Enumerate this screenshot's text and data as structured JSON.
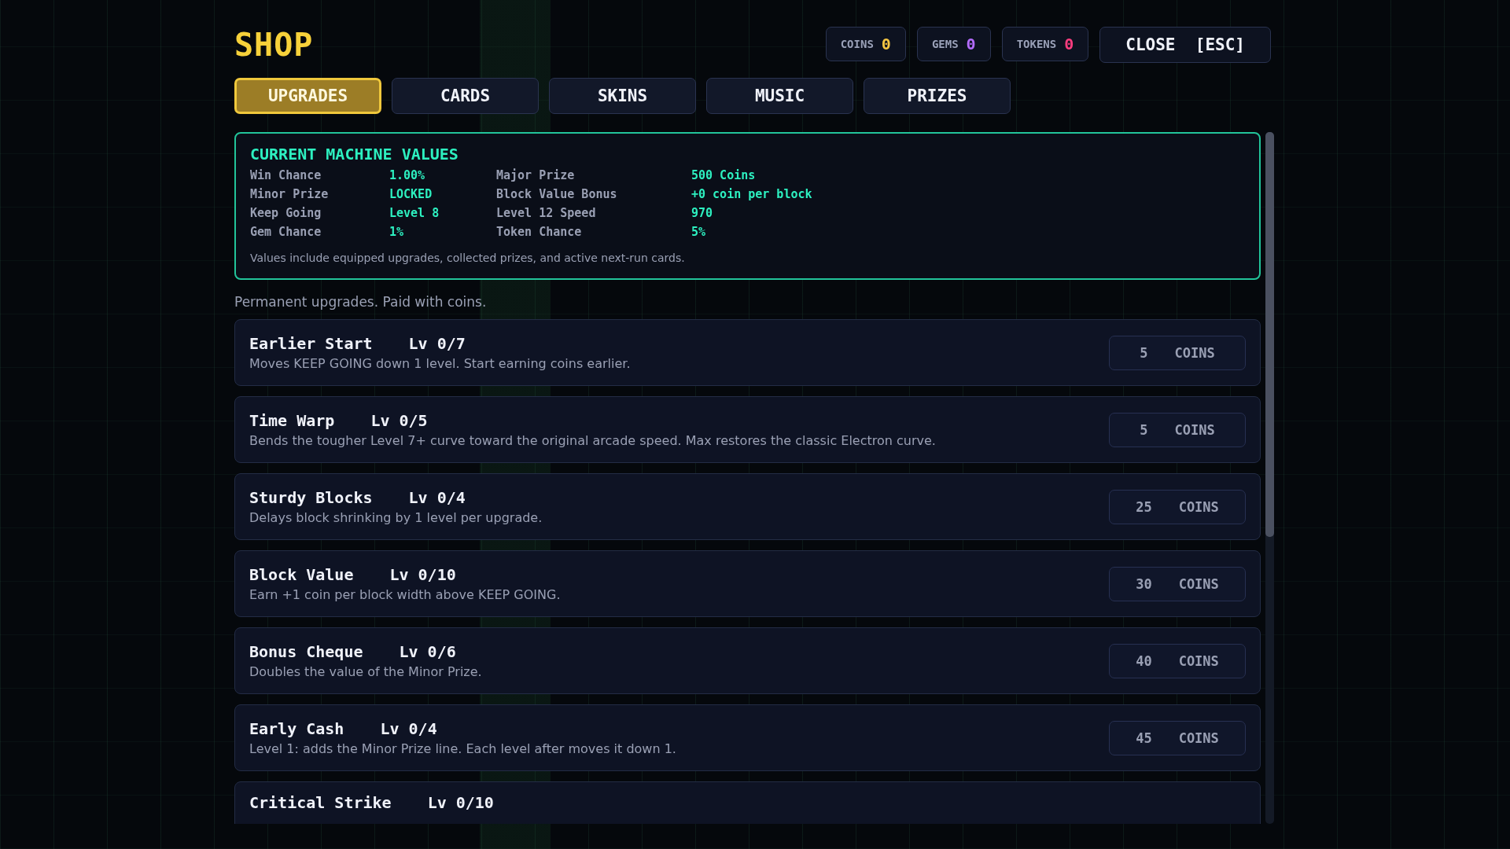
{
  "title": "SHOP",
  "currencies": [
    {
      "label": "COINS",
      "value": "0",
      "color": "#f5c542"
    },
    {
      "label": "GEMS",
      "value": "0",
      "color": "#b46cff"
    },
    {
      "label": "TOKENS",
      "value": "0",
      "color": "#ff3d7f"
    }
  ],
  "close_button": "CLOSE  [ESC]",
  "tabs": [
    {
      "label": "UPGRADES",
      "selected": true
    },
    {
      "label": "CARDS",
      "selected": false
    },
    {
      "label": "SKINS",
      "selected": false
    },
    {
      "label": "MUSIC",
      "selected": false
    },
    {
      "label": "PRIZES",
      "selected": false
    }
  ],
  "machine_values": {
    "title": "CURRENT MACHINE VALUES",
    "rows": [
      {
        "label": "Win Chance",
        "value": "1.00%",
        "label_2": "Major Prize",
        "value_2": "500 Coins"
      },
      {
        "label": "Minor Prize",
        "value": "LOCKED",
        "label_2": "Block Value Bonus",
        "value_2": "+0 coin per block"
      },
      {
        "label": "Keep Going",
        "value": "Level 8",
        "label_2": "Level 12 Speed",
        "value_2": "970"
      },
      {
        "label": "Gem Chance",
        "value": "1%",
        "label_2": "Token Chance",
        "value_2": "5%"
      }
    ],
    "note": "Values include equipped upgrades, collected prizes, and active next-run cards."
  },
  "section_note": "Permanent upgrades. Paid with coins.",
  "upgrades": [
    {
      "name": "Earlier Start",
      "level": "Lv 0/7",
      "description": "Moves KEEP GOING down 1 level. Start earning coins earlier.",
      "price": "5",
      "unit": "COINS"
    },
    {
      "name": "Time Warp",
      "level": "Lv 0/5",
      "description": "Bends the tougher Level 7+ curve toward the original arcade speed. Max restores the classic Electron curve.",
      "price": "5",
      "unit": "COINS"
    },
    {
      "name": "Sturdy Blocks",
      "level": "Lv 0/4",
      "description": "Delays block shrinking by 1 level per upgrade.",
      "price": "25",
      "unit": "COINS"
    },
    {
      "name": "Block Value",
      "level": "Lv 0/10",
      "description": "Earn +1 coin per block width above KEEP GOING.",
      "price": "30",
      "unit": "COINS"
    },
    {
      "name": "Bonus Cheque",
      "level": "Lv 0/6",
      "description": "Doubles the value of the Minor Prize.",
      "price": "40",
      "unit": "COINS"
    },
    {
      "name": "Early Cash",
      "level": "Lv 0/4",
      "description": "Level 1: adds the Minor Prize line. Each level after moves it down 1.",
      "price": "45",
      "unit": "COINS"
    },
    {
      "name": "Critical Strike",
      "level": "Lv 0/10"
    }
  ]
}
